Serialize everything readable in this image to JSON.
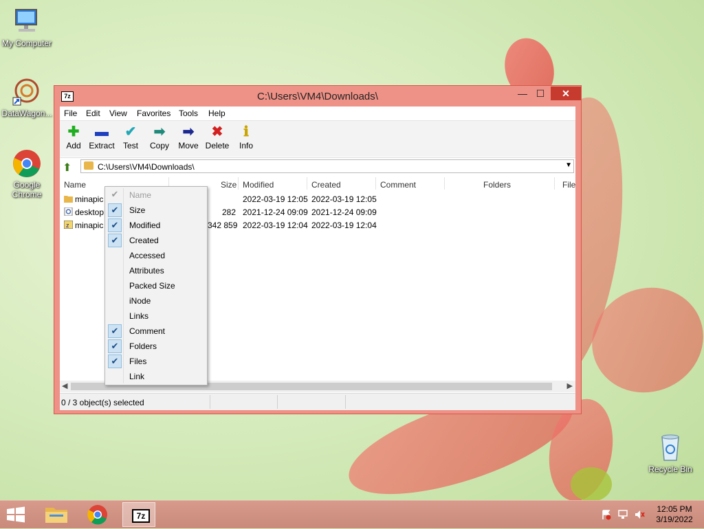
{
  "desktop": {
    "icons": [
      {
        "label": "My Computer"
      },
      {
        "label": "DataWagon..."
      },
      {
        "label": "Google Chrome"
      },
      {
        "label": "Recycle Bin"
      }
    ]
  },
  "window": {
    "title": "C:\\Users\\VM4\\Downloads\\",
    "app_icon": "7z",
    "controls": {
      "minimize": "—",
      "maximize": "☐",
      "close": "✕"
    }
  },
  "menu": [
    "File",
    "Edit",
    "View",
    "Favorites",
    "Tools",
    "Help"
  ],
  "toolbar": [
    {
      "label": "Add",
      "icon": "plus-icon",
      "glyph": "✚",
      "color": "#1fae1f"
    },
    {
      "label": "Extract",
      "icon": "minus-icon",
      "glyph": "▬",
      "color": "#1f3fbf"
    },
    {
      "label": "Test",
      "icon": "check-icon",
      "glyph": "✔",
      "color": "#22a7b5"
    },
    {
      "label": "Copy",
      "icon": "copy-arrow-icon",
      "glyph": "➡",
      "color": "#1f8a7a"
    },
    {
      "label": "Move",
      "icon": "move-arrow-icon",
      "glyph": "➡",
      "color": "#1c2a8f"
    },
    {
      "label": "Delete",
      "icon": "delete-x-icon",
      "glyph": "✖",
      "color": "#d32020"
    },
    {
      "label": "Info",
      "icon": "info-icon",
      "glyph": "ℹ",
      "color": "#c9a400"
    }
  ],
  "address": {
    "path": "C:\\Users\\VM4\\Downloads\\"
  },
  "columns": [
    "Name",
    "Size",
    "Modified",
    "Created",
    "Comment",
    "Folders",
    "File"
  ],
  "rows": [
    {
      "name": "minapic",
      "size": "",
      "modified": "2022-03-19 12:05",
      "created": "2022-03-19 12:05",
      "type": "folder"
    },
    {
      "name": "desktop",
      "size": "282",
      "modified": "2021-12-24 09:09",
      "created": "2021-12-24 09:09",
      "type": "settings"
    },
    {
      "name": "minapic",
      "size": "342 859",
      "modified": "2022-03-19 12:04",
      "created": "2022-03-19 12:04",
      "type": "archive"
    }
  ],
  "status": {
    "text": "0 / 3 object(s) selected"
  },
  "context_menu": {
    "items": [
      {
        "label": "Name",
        "checked": true,
        "disabled": true
      },
      {
        "label": "Size",
        "checked": true,
        "disabled": false
      },
      {
        "label": "Modified",
        "checked": true,
        "disabled": false
      },
      {
        "label": "Created",
        "checked": true,
        "disabled": false
      },
      {
        "label": "Accessed",
        "checked": false,
        "disabled": false
      },
      {
        "label": "Attributes",
        "checked": false,
        "disabled": false
      },
      {
        "label": "Packed Size",
        "checked": false,
        "disabled": false
      },
      {
        "label": "iNode",
        "checked": false,
        "disabled": false
      },
      {
        "label": "Links",
        "checked": false,
        "disabled": false
      },
      {
        "label": "Comment",
        "checked": true,
        "disabled": false
      },
      {
        "label": "Folders",
        "checked": true,
        "disabled": false
      },
      {
        "label": "Files",
        "checked": true,
        "disabled": false
      },
      {
        "label": "Link",
        "checked": false,
        "disabled": false
      }
    ]
  },
  "taskbar": {
    "apps": [
      {
        "name": "file-explorer"
      },
      {
        "name": "google-chrome"
      },
      {
        "name": "7zip",
        "label": "7z",
        "active": true
      }
    ],
    "clock": {
      "time": "12:05 PM",
      "date": "3/19/2022"
    }
  }
}
